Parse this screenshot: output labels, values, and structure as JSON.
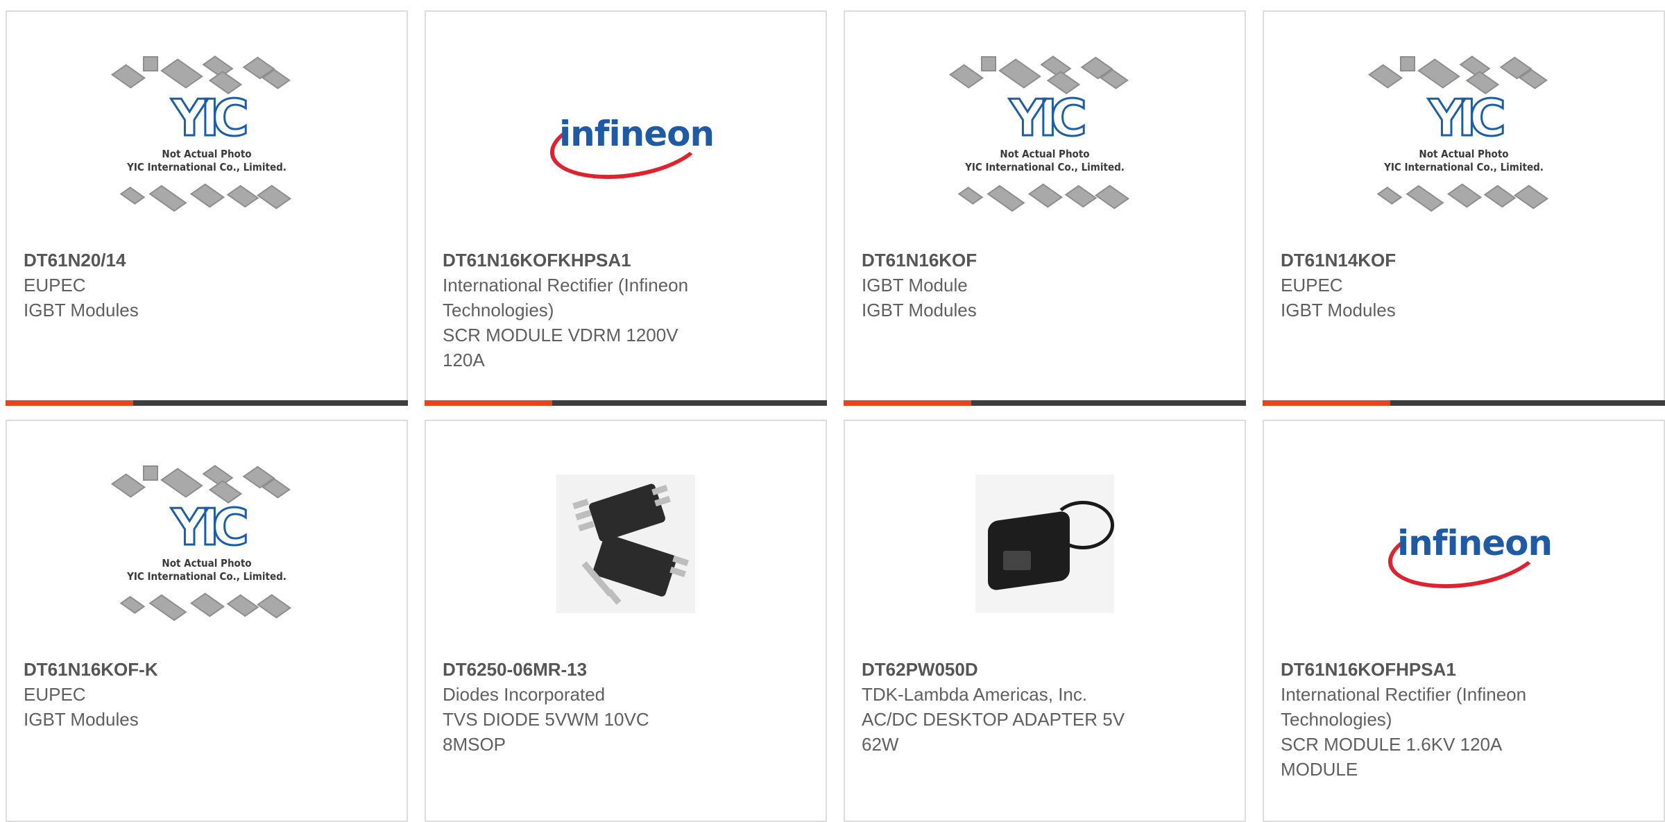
{
  "products": [
    {
      "part": "DT61N20/14",
      "lines": [
        "EUPEC",
        "IGBT Modules"
      ],
      "image": "yic-placeholder",
      "image_text": [
        "Not Actual Photo",
        "YIC International Co., Limited."
      ]
    },
    {
      "part": "DT61N16KOFKHPSA1",
      "lines": [
        "International Rectifier (Infineon",
        "Technologies)",
        "SCR MODULE VDRM 1200V",
        "120A"
      ],
      "image": "infineon-logo",
      "image_text": [
        "infineon"
      ]
    },
    {
      "part": "DT61N16KOF",
      "lines": [
        "IGBT Module",
        "IGBT Modules"
      ],
      "image": "yic-placeholder",
      "image_text": [
        "Not Actual Photo",
        "YIC International Co., Limited."
      ]
    },
    {
      "part": "DT61N14KOF",
      "lines": [
        "EUPEC",
        "IGBT Modules"
      ],
      "image": "yic-placeholder",
      "image_text": [
        "Not Actual Photo",
        "YIC International Co., Limited."
      ]
    },
    {
      "part": "DT61N16KOF-K",
      "lines": [
        "EUPEC",
        "IGBT Modules"
      ],
      "image": "yic-placeholder",
      "image_text": [
        "Not Actual Photo",
        "YIC International Co., Limited."
      ]
    },
    {
      "part": "DT6250-06MR-13",
      "lines": [
        "Diodes Incorporated",
        "TVS DIODE 5VWM 10VC",
        "8MSOP"
      ],
      "image": "msop-chip-photo"
    },
    {
      "part": "DT62PW050D",
      "lines": [
        "TDK-Lambda Americas, Inc.",
        "AC/DC DESKTOP ADAPTER 5V",
        "62W"
      ],
      "image": "power-adapter-photo"
    },
    {
      "part": "DT61N16KOFHPSA1",
      "lines": [
        "International Rectifier (Infineon",
        "Technologies)",
        "SCR MODULE 1.6KV 120A",
        "MODULE"
      ],
      "image": "infineon-logo",
      "image_text": [
        "infineon"
      ]
    }
  ],
  "colors": {
    "accent": "#e8441c",
    "bar": "#3d3d3d",
    "text": "#5f5f5f",
    "border": "#dcdcdc"
  }
}
